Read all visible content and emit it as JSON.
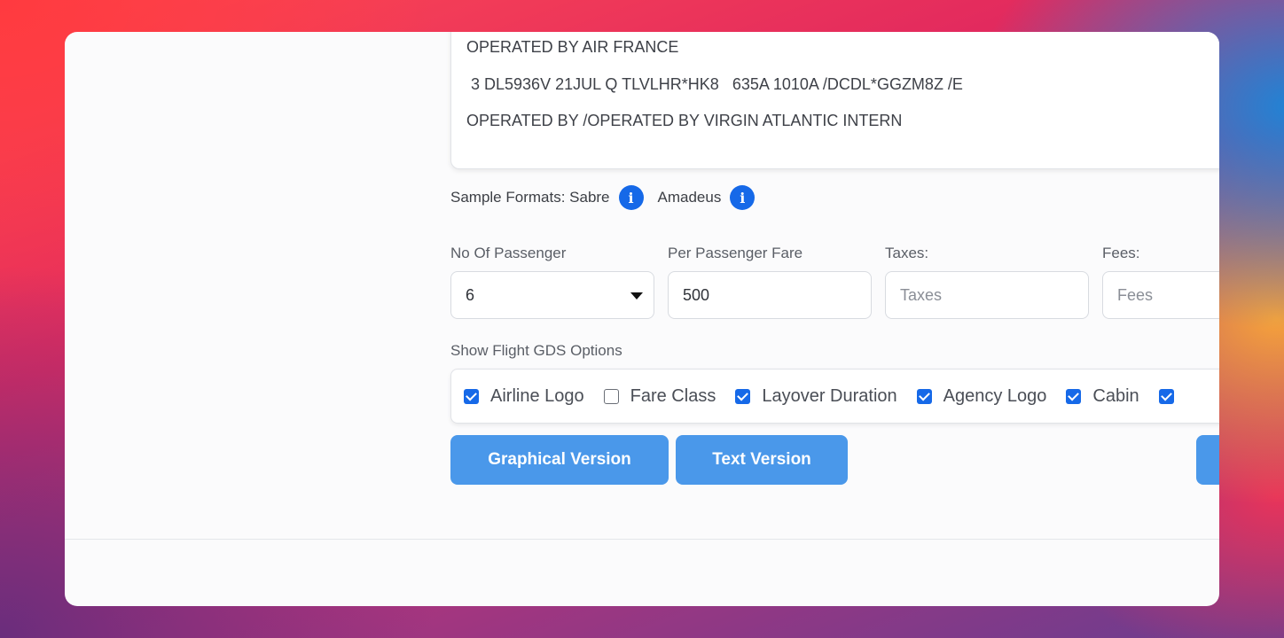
{
  "gds": {
    "lines": [
      "OPERATED BY AIR FRANCE",
      " 3 DL5936V 21JUL Q TLVLHR*HK8   635A 1010A /DCDL*GGZM8Z /E",
      "OPERATED BY /OPERATED BY VIRGIN ATLANTIC INTERN"
    ]
  },
  "formats": {
    "label": "Sample Formats: Sabre",
    "amadeus": "Amadeus",
    "info_icon": "i"
  },
  "fields": {
    "passengers": {
      "label": "No Of Passenger",
      "value": "6"
    },
    "fare": {
      "label": "Per Passenger Fare",
      "value": "500"
    },
    "taxes": {
      "label": "Taxes:",
      "placeholder": "Taxes"
    },
    "fees": {
      "label": "Fees:",
      "placeholder": "Fees"
    }
  },
  "options": {
    "label": "Show Flight GDS Options",
    "items": [
      {
        "label": "Airline Logo",
        "checked": true
      },
      {
        "label": "Fare Class",
        "checked": false
      },
      {
        "label": "Layover Duration",
        "checked": true
      },
      {
        "label": "Agency Logo",
        "checked": true
      },
      {
        "label": "Cabin",
        "checked": true
      }
    ]
  },
  "buttons": {
    "graphical": "Graphical Version",
    "text": "Text Version"
  },
  "colors": {
    "accent": "#1669e8",
    "button": "#4a98ea"
  }
}
